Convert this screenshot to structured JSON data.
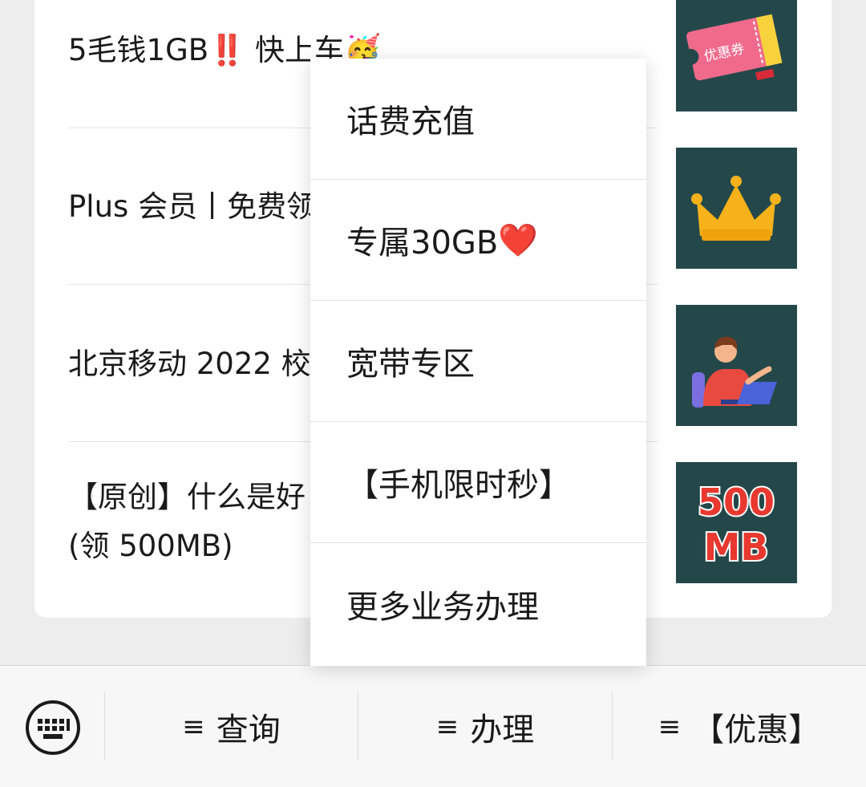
{
  "articles": [
    {
      "title": "5毛钱1GB‼️ 快上车🥳",
      "thumb_icon": "coupon-icon",
      "thumb_text": "优惠券"
    },
    {
      "title": "Plus 会员丨免费领",
      "thumb_icon": "crown-icon"
    },
    {
      "title": "北京移动 2022 校",
      "thumb_icon": "person-laptop-icon"
    },
    {
      "title": "【原创】什么是好\n(领 500MB)",
      "thumb_icon": "500mb-icon",
      "thumb_text_top": "500",
      "thumb_text_bottom": "MB"
    }
  ],
  "popup_menu": {
    "items": [
      {
        "label": "话费充值"
      },
      {
        "label": "专属30GB",
        "suffix": "❤️"
      },
      {
        "label": "宽带专区"
      },
      {
        "label": "【手机限时秒】"
      },
      {
        "label": "更多业务办理"
      }
    ]
  },
  "bottom_bar": {
    "keyboard_icon": "keyboard-icon",
    "tabs": [
      {
        "glyph": "≡",
        "label": "查询"
      },
      {
        "glyph": "≡",
        "label": "办理"
      },
      {
        "glyph": "≡",
        "label": "【优惠】"
      }
    ]
  },
  "colors": {
    "thumb_bg": "#24484a",
    "coupon_pink": "#f06a8c",
    "crown_gold": "#f5b21b",
    "badge_red": "#e8382f"
  }
}
